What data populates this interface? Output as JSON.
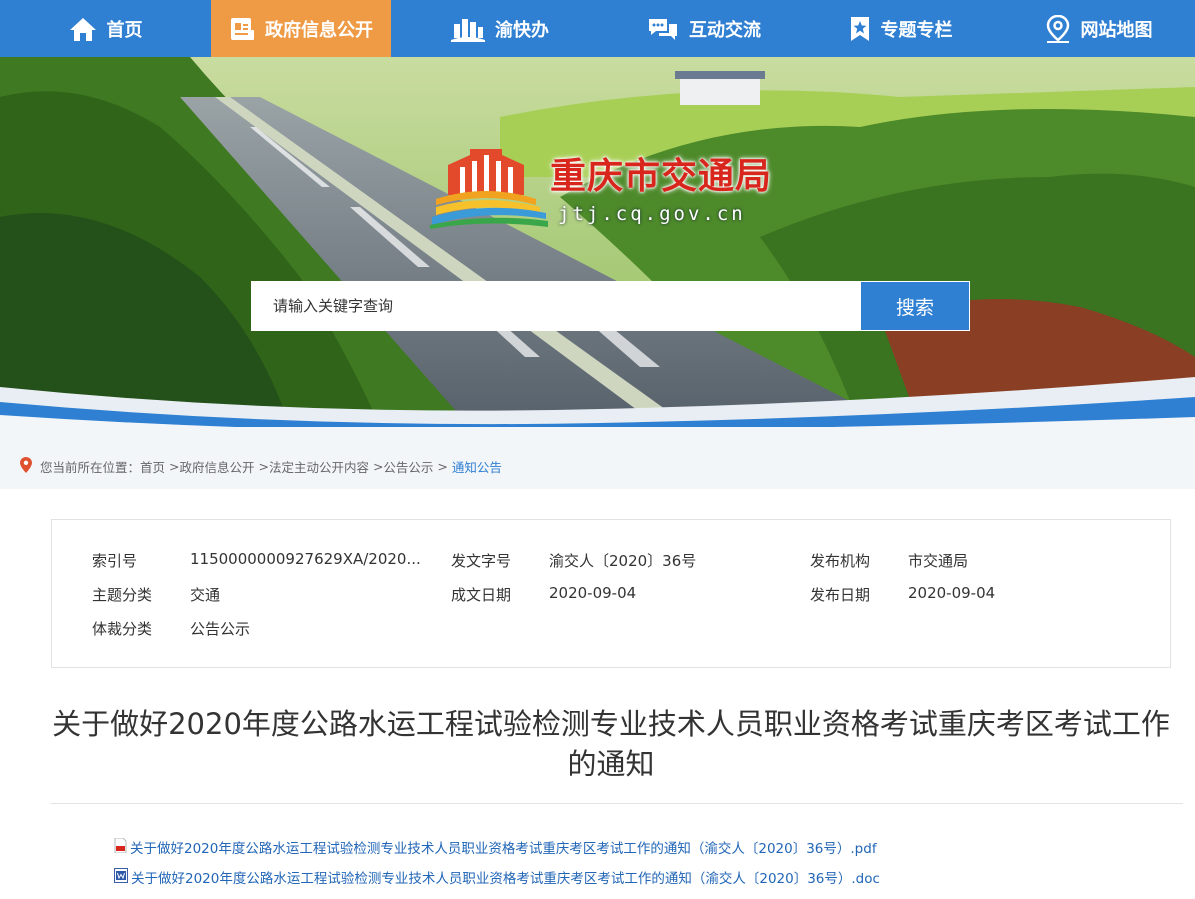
{
  "nav": {
    "items": [
      {
        "label": "首页",
        "icon": "home-icon"
      },
      {
        "label": "政府信息公开",
        "icon": "document-icon",
        "active": true
      },
      {
        "label": "渝快办",
        "icon": "buildings-icon"
      },
      {
        "label": "互动交流",
        "icon": "chat-icon"
      },
      {
        "label": "专题专栏",
        "icon": "star-bookmark-icon"
      },
      {
        "label": "网站地图",
        "icon": "map-pin-icon"
      }
    ]
  },
  "banner": {
    "title": "重庆市交通局",
    "domain": "jtj.cq.gov.cn"
  },
  "search": {
    "placeholder": "请输入关键字查询",
    "button_label": "搜索"
  },
  "breadcrumb": {
    "prefix": "您当前所在位置：",
    "items": [
      "首页",
      "政府信息公开",
      "法定主动公开内容",
      "公告公示"
    ],
    "current": "通知公告"
  },
  "meta": {
    "index_label": "索引号",
    "index_value": "1150000000927629XA/2020...",
    "docno_label": "发文字号",
    "docno_value": "渝交人〔2020〕36号",
    "publisher_label": "发布机构",
    "publisher_value": "市交通局",
    "topic_label": "主题分类",
    "topic_value": "交通",
    "written_label": "成文日期",
    "written_value": "2020-09-04",
    "pubdate_label": "发布日期",
    "pubdate_value": "2020-09-04",
    "genre_label": "体裁分类",
    "genre_value": "公告公示"
  },
  "article": {
    "title": "关于做好2020年度公路水运工程试验检测专业技术人员职业资格考试重庆考区考试工作的通知"
  },
  "attachments": [
    {
      "name": "关于做好2020年度公路水运工程试验检测专业技术人员职业资格考试重庆考区考试工作的通知（渝交人〔2020〕36号）.pdf",
      "icon": "pdf-file-icon"
    },
    {
      "name": "关于做好2020年度公路水运工程试验检测专业技术人员职业资格考试重庆考区考试工作的通知（渝交人〔2020〕36号）.doc",
      "icon": "word-file-icon"
    }
  ],
  "colors": {
    "nav_blue": "#2f7fd2",
    "nav_active": "#ef9a44",
    "title_red": "#d8261c",
    "link_blue": "#2266b7"
  }
}
